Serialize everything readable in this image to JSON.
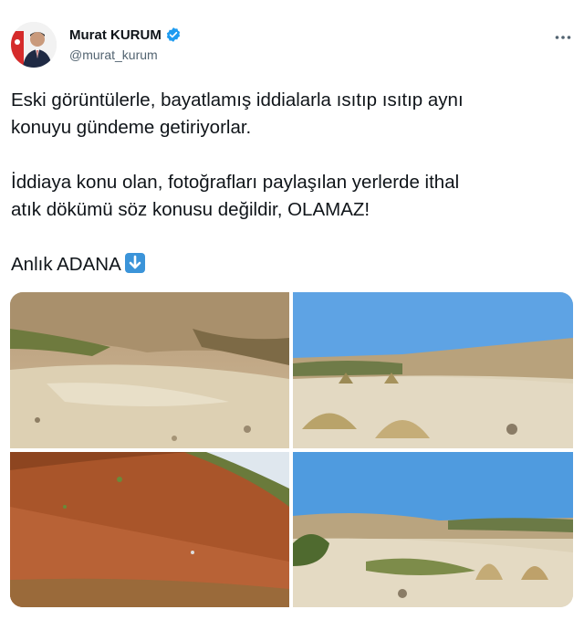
{
  "author": {
    "display_name": "Murat KURUM",
    "handle": "@murat_kurum",
    "verified": true
  },
  "more_icon": "more-horizontal-icon",
  "tweet": {
    "line1": "Eski görüntülerle, bayatlamış iddialarla ısıtıp ısıtıp aynı",
    "line2": "konuyu gündeme getiriyorlar.",
    "line3": "İddiaya konu olan, fotoğrafları paylaşılan yerlerde ithal",
    "line4": "atık dökümü söz konusu değildir, OLAMAZ!",
    "line5": "Anlık ADANA",
    "emoji": "down-arrow-emoji-icon"
  },
  "colors": {
    "verified": "#1d9bf0",
    "sky": "#4f9bdf",
    "soil_red": "#a9552a",
    "sand": "#d8cba8"
  }
}
